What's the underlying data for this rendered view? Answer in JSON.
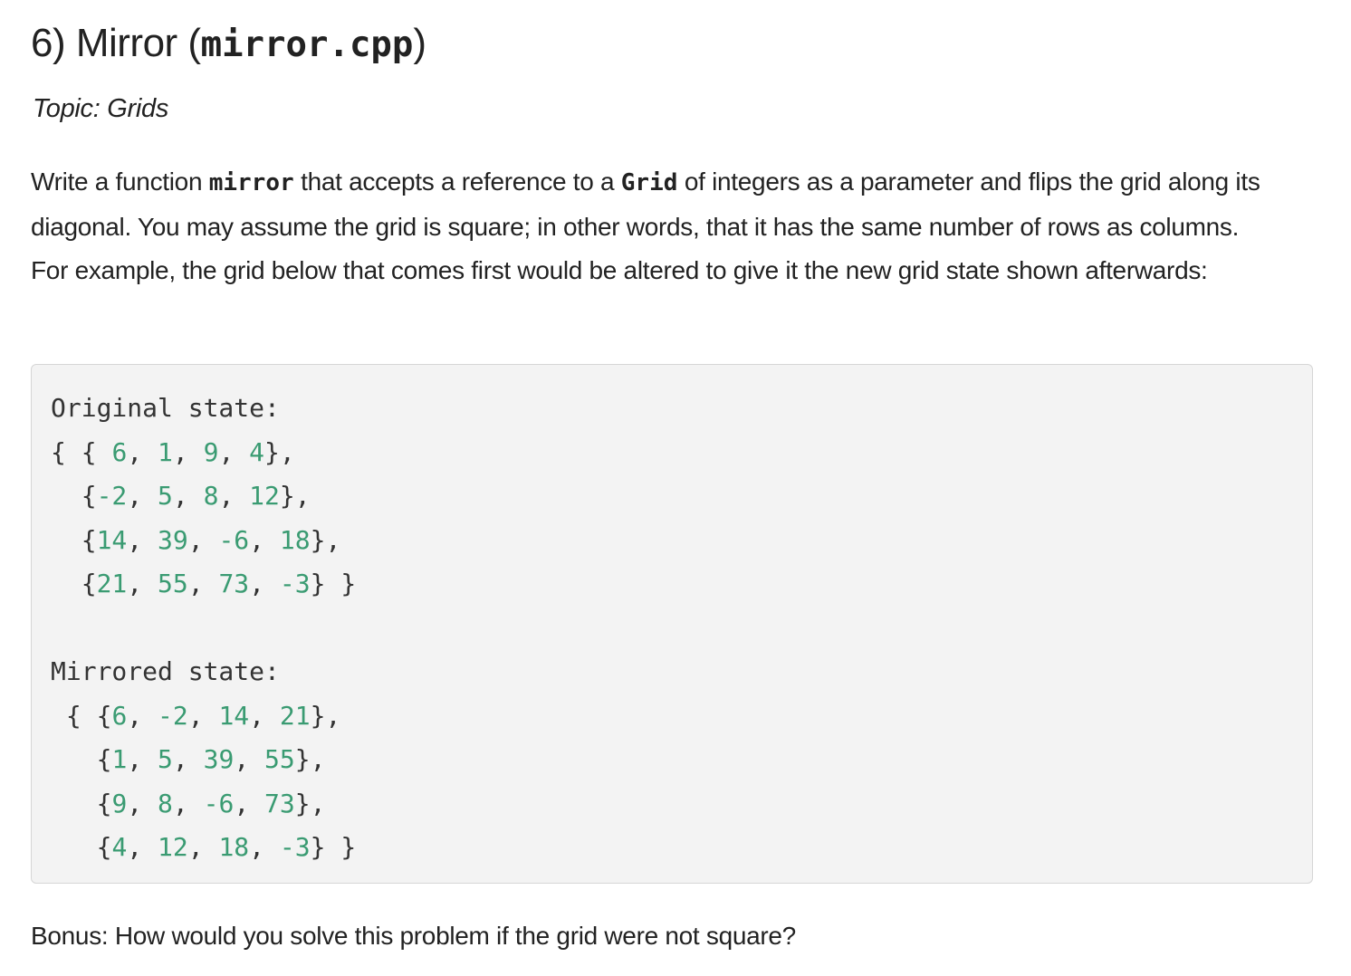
{
  "heading": {
    "prefix": "6) Mirror (",
    "filename": "mirror.cpp",
    "suffix": ")"
  },
  "topic": "Topic: Grids",
  "description": {
    "part1": "Write a function ",
    "code1": "mirror",
    "part2": " that accepts a reference to a ",
    "code2": "Grid",
    "part3": " of integers as a parameter and flips the grid along its diagonal. You may assume the grid is square; in other words, that it has the same number of rows as columns. For example, the grid below that comes first would be altered to give it the new grid state shown afterwards:"
  },
  "code_block": {
    "lines": [
      [
        {
          "t": "Original state:",
          "n": false
        }
      ],
      [
        {
          "t": "{ { ",
          "n": false
        },
        {
          "t": "6",
          "n": true
        },
        {
          "t": ", ",
          "n": false
        },
        {
          "t": "1",
          "n": true
        },
        {
          "t": ", ",
          "n": false
        },
        {
          "t": "9",
          "n": true
        },
        {
          "t": ", ",
          "n": false
        },
        {
          "t": "4",
          "n": true
        },
        {
          "t": "},",
          "n": false
        }
      ],
      [
        {
          "t": "  {",
          "n": false
        },
        {
          "t": "-2",
          "n": true
        },
        {
          "t": ", ",
          "n": false
        },
        {
          "t": "5",
          "n": true
        },
        {
          "t": ", ",
          "n": false
        },
        {
          "t": "8",
          "n": true
        },
        {
          "t": ", ",
          "n": false
        },
        {
          "t": "12",
          "n": true
        },
        {
          "t": "},",
          "n": false
        }
      ],
      [
        {
          "t": "  {",
          "n": false
        },
        {
          "t": "14",
          "n": true
        },
        {
          "t": ", ",
          "n": false
        },
        {
          "t": "39",
          "n": true
        },
        {
          "t": ", ",
          "n": false
        },
        {
          "t": "-6",
          "n": true
        },
        {
          "t": ", ",
          "n": false
        },
        {
          "t": "18",
          "n": true
        },
        {
          "t": "},",
          "n": false
        }
      ],
      [
        {
          "t": "  {",
          "n": false
        },
        {
          "t": "21",
          "n": true
        },
        {
          "t": ", ",
          "n": false
        },
        {
          "t": "55",
          "n": true
        },
        {
          "t": ", ",
          "n": false
        },
        {
          "t": "73",
          "n": true
        },
        {
          "t": ", ",
          "n": false
        },
        {
          "t": "-3",
          "n": true
        },
        {
          "t": "} }",
          "n": false
        }
      ],
      [
        {
          "t": "",
          "n": false
        }
      ],
      [
        {
          "t": "Mirrored state:",
          "n": false
        }
      ],
      [
        {
          "t": " { {",
          "n": false
        },
        {
          "t": "6",
          "n": true
        },
        {
          "t": ", ",
          "n": false
        },
        {
          "t": "-2",
          "n": true
        },
        {
          "t": ", ",
          "n": false
        },
        {
          "t": "14",
          "n": true
        },
        {
          "t": ", ",
          "n": false
        },
        {
          "t": "21",
          "n": true
        },
        {
          "t": "},",
          "n": false
        }
      ],
      [
        {
          "t": "   {",
          "n": false
        },
        {
          "t": "1",
          "n": true
        },
        {
          "t": ", ",
          "n": false
        },
        {
          "t": "5",
          "n": true
        },
        {
          "t": ", ",
          "n": false
        },
        {
          "t": "39",
          "n": true
        },
        {
          "t": ", ",
          "n": false
        },
        {
          "t": "55",
          "n": true
        },
        {
          "t": "},",
          "n": false
        }
      ],
      [
        {
          "t": "   {",
          "n": false
        },
        {
          "t": "9",
          "n": true
        },
        {
          "t": ", ",
          "n": false
        },
        {
          "t": "8",
          "n": true
        },
        {
          "t": ", ",
          "n": false
        },
        {
          "t": "-6",
          "n": true
        },
        {
          "t": ", ",
          "n": false
        },
        {
          "t": "73",
          "n": true
        },
        {
          "t": "},",
          "n": false
        }
      ],
      [
        {
          "t": "   {",
          "n": false
        },
        {
          "t": "4",
          "n": true
        },
        {
          "t": ", ",
          "n": false
        },
        {
          "t": "12",
          "n": true
        },
        {
          "t": ", ",
          "n": false
        },
        {
          "t": "18",
          "n": true
        },
        {
          "t": ", ",
          "n": false
        },
        {
          "t": "-3",
          "n": true
        },
        {
          "t": "} }",
          "n": false
        }
      ]
    ]
  },
  "bonus": "Bonus: How would you solve this problem if the grid were not square?",
  "colors": {
    "text": "#222222",
    "code_text": "#333333",
    "number": "#3a9b72",
    "code_background": "#f3f3f3",
    "code_border": "#d6d6d6"
  }
}
